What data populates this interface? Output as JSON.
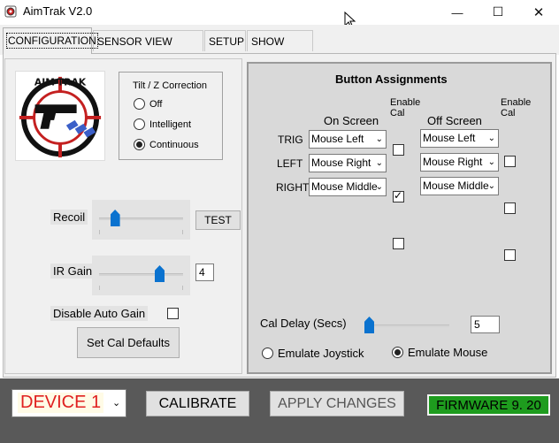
{
  "window": {
    "title": "AimTrak V2.0",
    "minimize_glyph": "—",
    "maximize_glyph": "☐",
    "close_glyph": "✕"
  },
  "tabs": [
    {
      "label": "CONFIGURATION",
      "active": true
    },
    {
      "label": "SENSOR VIEW CHECK",
      "active": false
    },
    {
      "label": "SETUP",
      "active": false
    },
    {
      "label": "SHOW DATA",
      "active": false
    }
  ],
  "tilt": {
    "title": "Tilt / Z Correction",
    "options": [
      "Off",
      "Intelligent",
      "Continuous"
    ],
    "selected": "Continuous"
  },
  "recoil": {
    "label": "Recoil",
    "level": 0.15,
    "test_label": "TEST"
  },
  "ir_gain": {
    "label": "IR Gain",
    "level": 0.75,
    "value": "4"
  },
  "disable_auto_gain": {
    "label": "Disable Auto Gain",
    "checked": false
  },
  "set_cal_defaults_label": "Set Cal  Defaults",
  "assignments": {
    "title": "Button Assignments",
    "on_screen_header": "On Screen",
    "off_screen_header": "Off Screen",
    "enable_cal_header": "Enable\nCal",
    "rows": [
      {
        "name": "TRIG",
        "on": "Mouse Left",
        "on_cal": false,
        "off": "Mouse Left",
        "off_cal": false
      },
      {
        "name": "LEFT",
        "on": "Mouse Right",
        "on_cal": true,
        "off": "Mouse Right",
        "off_cal": false
      },
      {
        "name": "RIGHT",
        "on": "Mouse Middle",
        "on_cal": false,
        "off": "Mouse Middle",
        "off_cal": false
      }
    ]
  },
  "cal_delay": {
    "label": "Cal Delay (Secs)",
    "level": 0.0,
    "value": "5"
  },
  "emulation": {
    "options": [
      "Emulate Joystick",
      "Emulate Mouse"
    ],
    "selected": "Emulate Mouse"
  },
  "bottom": {
    "device": "DEVICE 1",
    "calibrate_label": "CALIBRATE",
    "apply_label": "APPLY CHANGES",
    "firmware": "FIRMWARE 9. 20"
  },
  "colors": {
    "accent": "#0a72cf",
    "device_text": "#e02020",
    "firmware_bg": "#1e9c1e",
    "bottom_bar": "#595959"
  }
}
